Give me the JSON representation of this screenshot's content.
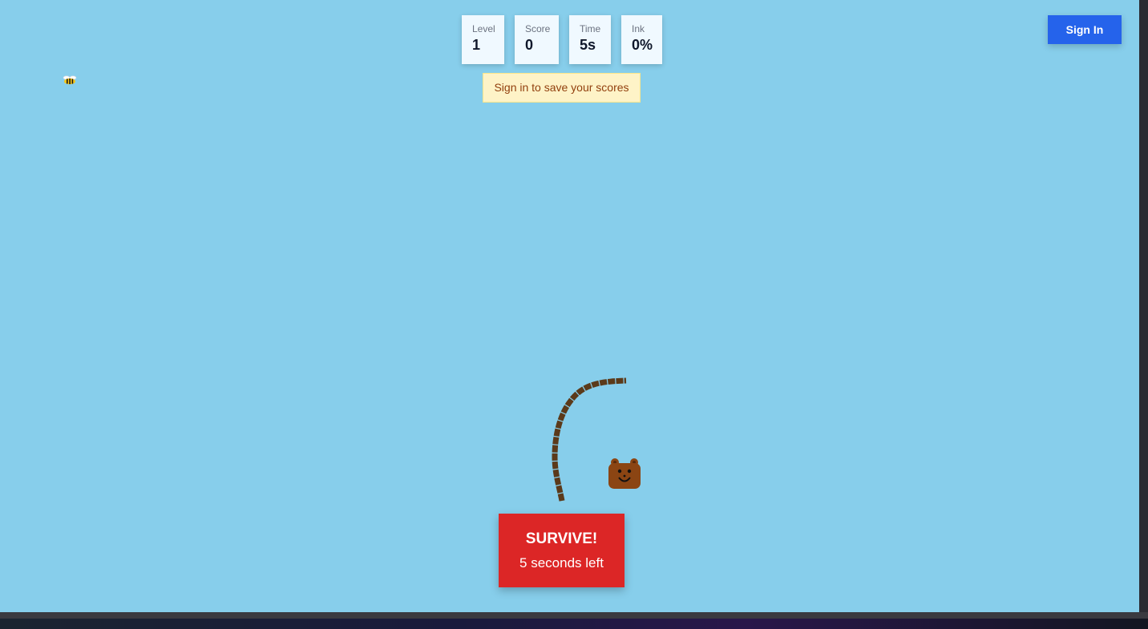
{
  "game": {
    "background_color": "#87ceeb",
    "hud": {
      "level": {
        "label": "Level",
        "value": "1"
      },
      "score": {
        "label": "Score",
        "value": "0"
      },
      "time": {
        "label": "Time",
        "value": "5s"
      },
      "ink": {
        "label": "Ink",
        "value": "0%"
      }
    },
    "save_hint": "Sign in to save your scores",
    "sign_in_label": "Sign In",
    "banner": {
      "title": "SURVIVE!",
      "subtitle": "5 seconds left"
    },
    "sprites": {
      "bee": "bee-icon",
      "bear": "bear-icon",
      "line": "drawn-line"
    },
    "colors": {
      "accent": "#2563eb",
      "banner": "#dc2626",
      "line": "#5b3a1a",
      "bear": "#8b4513",
      "hint_bg": "#fef3c7",
      "hint_text": "#92400e"
    }
  }
}
